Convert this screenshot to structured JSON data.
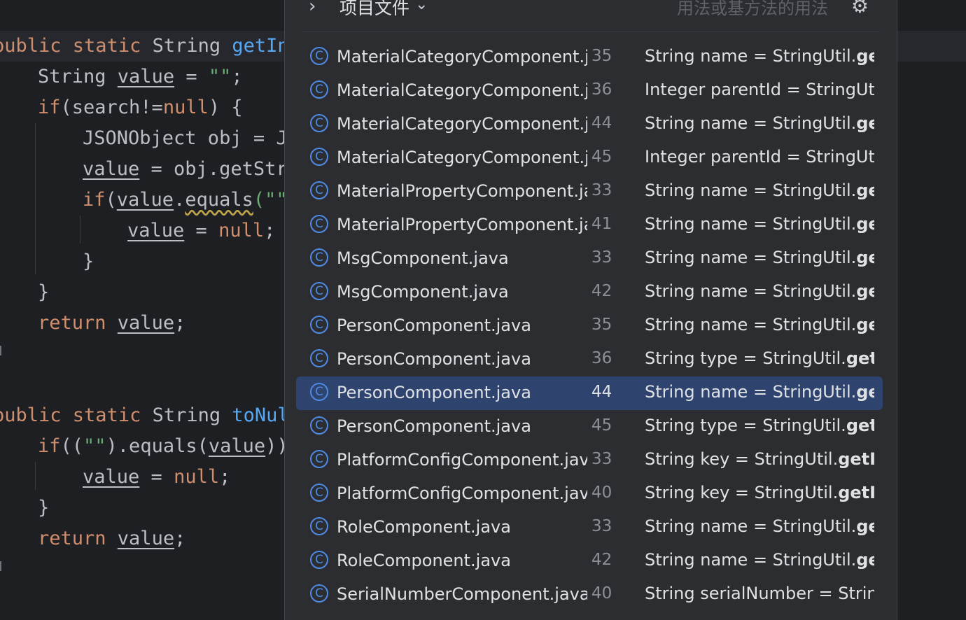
{
  "editor": {
    "lines": [
      {
        "parts": [
          {
            "t": "public ",
            "c": "kw"
          },
          {
            "t": "static ",
            "c": "kw"
          },
          {
            "t": "String ",
            "c": ""
          },
          {
            "t": "getIn",
            "c": "fn"
          }
        ]
      },
      {
        "parts": [
          {
            "t": "String ",
            "c": ""
          },
          {
            "t": "value",
            "c": "var"
          },
          {
            "t": " = ",
            "c": ""
          },
          {
            "t": "\"\"",
            "c": "str"
          },
          {
            "t": ";",
            "c": ""
          }
        ]
      },
      {
        "parts": [
          {
            "t": "if",
            "c": "kw"
          },
          {
            "t": "(search!=",
            "c": ""
          },
          {
            "t": "null",
            "c": "kw"
          },
          {
            "t": ") {",
            "c": ""
          }
        ]
      },
      {
        "parts": [
          {
            "t": "JSONObject obj = J",
            "c": ""
          }
        ]
      },
      {
        "parts": [
          {
            "t": "value",
            "c": "var"
          },
          {
            "t": " = obj.getStr",
            "c": ""
          }
        ]
      },
      {
        "parts": [
          {
            "t": "if",
            "c": "kw"
          },
          {
            "t": "(",
            "c": ""
          },
          {
            "t": "value",
            "c": "var"
          },
          {
            "t": ".",
            "c": ""
          },
          {
            "t": "equals",
            "c": "warn"
          },
          {
            "t": "(\"\"",
            "c": "str"
          }
        ]
      },
      {
        "parts": [
          {
            "t": "value",
            "c": "var"
          },
          {
            "t": " = ",
            "c": ""
          },
          {
            "t": "null",
            "c": "kw"
          },
          {
            "t": ";",
            "c": ""
          }
        ]
      },
      {
        "parts": [
          {
            "t": "}",
            "c": ""
          }
        ]
      },
      {
        "parts": [
          {
            "t": "}",
            "c": ""
          }
        ]
      },
      {
        "parts": [
          {
            "t": "return ",
            "c": "kw"
          },
          {
            "t": "value",
            "c": "var"
          },
          {
            "t": ";",
            "c": ""
          }
        ]
      },
      {
        "parts": [
          {
            "t": "public ",
            "c": "kw"
          },
          {
            "t": "static ",
            "c": "kw"
          },
          {
            "t": "String ",
            "c": ""
          },
          {
            "t": "toNul",
            "c": "fn"
          }
        ]
      },
      {
        "parts": [
          {
            "t": "if",
            "c": "kw"
          },
          {
            "t": "((",
            "c": ""
          },
          {
            "t": "\"\"",
            "c": "str"
          },
          {
            "t": ").equals(",
            "c": ""
          },
          {
            "t": "value",
            "c": "var"
          },
          {
            "t": "))",
            "c": ""
          }
        ]
      },
      {
        "parts": [
          {
            "t": "value",
            "c": "var"
          },
          {
            "t": " = ",
            "c": ""
          },
          {
            "t": "null",
            "c": "kw"
          },
          {
            "t": ";",
            "c": ""
          }
        ]
      },
      {
        "parts": [
          {
            "t": "}",
            "c": ""
          }
        ]
      },
      {
        "parts": [
          {
            "t": "return ",
            "c": "kw"
          },
          {
            "t": "value",
            "c": "var"
          },
          {
            "t": ";",
            "c": ""
          }
        ]
      }
    ]
  },
  "popup": {
    "scope_label": "项目文件",
    "search_hint": "用法或基方法的用法",
    "icons": {
      "expand": "chevron-right-icon",
      "scope_dropdown": "chevron-down-icon",
      "settings": "gear-icon",
      "class": "class-c-icon"
    },
    "accent_color": "#4f8be5",
    "selected_index": 10,
    "results": [
      {
        "file": "MaterialCategoryComponent.java",
        "line": "35",
        "pre": "String name = StringUtil.",
        "bold": "get"
      },
      {
        "file": "MaterialCategoryComponent.java",
        "line": "36",
        "pre": "Integer parentId = StringUtil",
        "bold": ""
      },
      {
        "file": "MaterialCategoryComponent.java",
        "line": "44",
        "pre": "String name = StringUtil.",
        "bold": "get"
      },
      {
        "file": "MaterialCategoryComponent.java",
        "line": "45",
        "pre": "Integer parentId = StringUtil",
        "bold": ""
      },
      {
        "file": "MaterialPropertyComponent.java",
        "line": "33",
        "pre": "String name = StringUtil.",
        "bold": "get"
      },
      {
        "file": "MaterialPropertyComponent.java",
        "line": "41",
        "pre": "String name = StringUtil.",
        "bold": "get"
      },
      {
        "file": "MsgComponent.java",
        "line": "33",
        "pre": "String name = StringUtil.",
        "bold": "get"
      },
      {
        "file": "MsgComponent.java",
        "line": "42",
        "pre": "String name = StringUtil.",
        "bold": "get"
      },
      {
        "file": "PersonComponent.java",
        "line": "35",
        "pre": "String name = StringUtil.",
        "bold": "get"
      },
      {
        "file": "PersonComponent.java",
        "line": "36",
        "pre": "String type = StringUtil.",
        "bold": "getIn"
      },
      {
        "file": "PersonComponent.java",
        "line": "44",
        "pre": "String name = StringUtil.",
        "bold": "get"
      },
      {
        "file": "PersonComponent.java",
        "line": "45",
        "pre": "String type = StringUtil.",
        "bold": "getIn"
      },
      {
        "file": "PlatformConfigComponent.java",
        "line": "33",
        "pre": "String key = StringUtil.",
        "bold": "getInt"
      },
      {
        "file": "PlatformConfigComponent.java",
        "line": "40",
        "pre": "String key = StringUtil.",
        "bold": "getInt"
      },
      {
        "file": "RoleComponent.java",
        "line": "33",
        "pre": "String name = StringUtil.",
        "bold": "get"
      },
      {
        "file": "RoleComponent.java",
        "line": "42",
        "pre": "String name = StringUtil.",
        "bold": "get"
      },
      {
        "file": "SerialNumberComponent.java",
        "line": "40",
        "pre": "String serialNumber = String",
        "bold": ""
      }
    ]
  }
}
